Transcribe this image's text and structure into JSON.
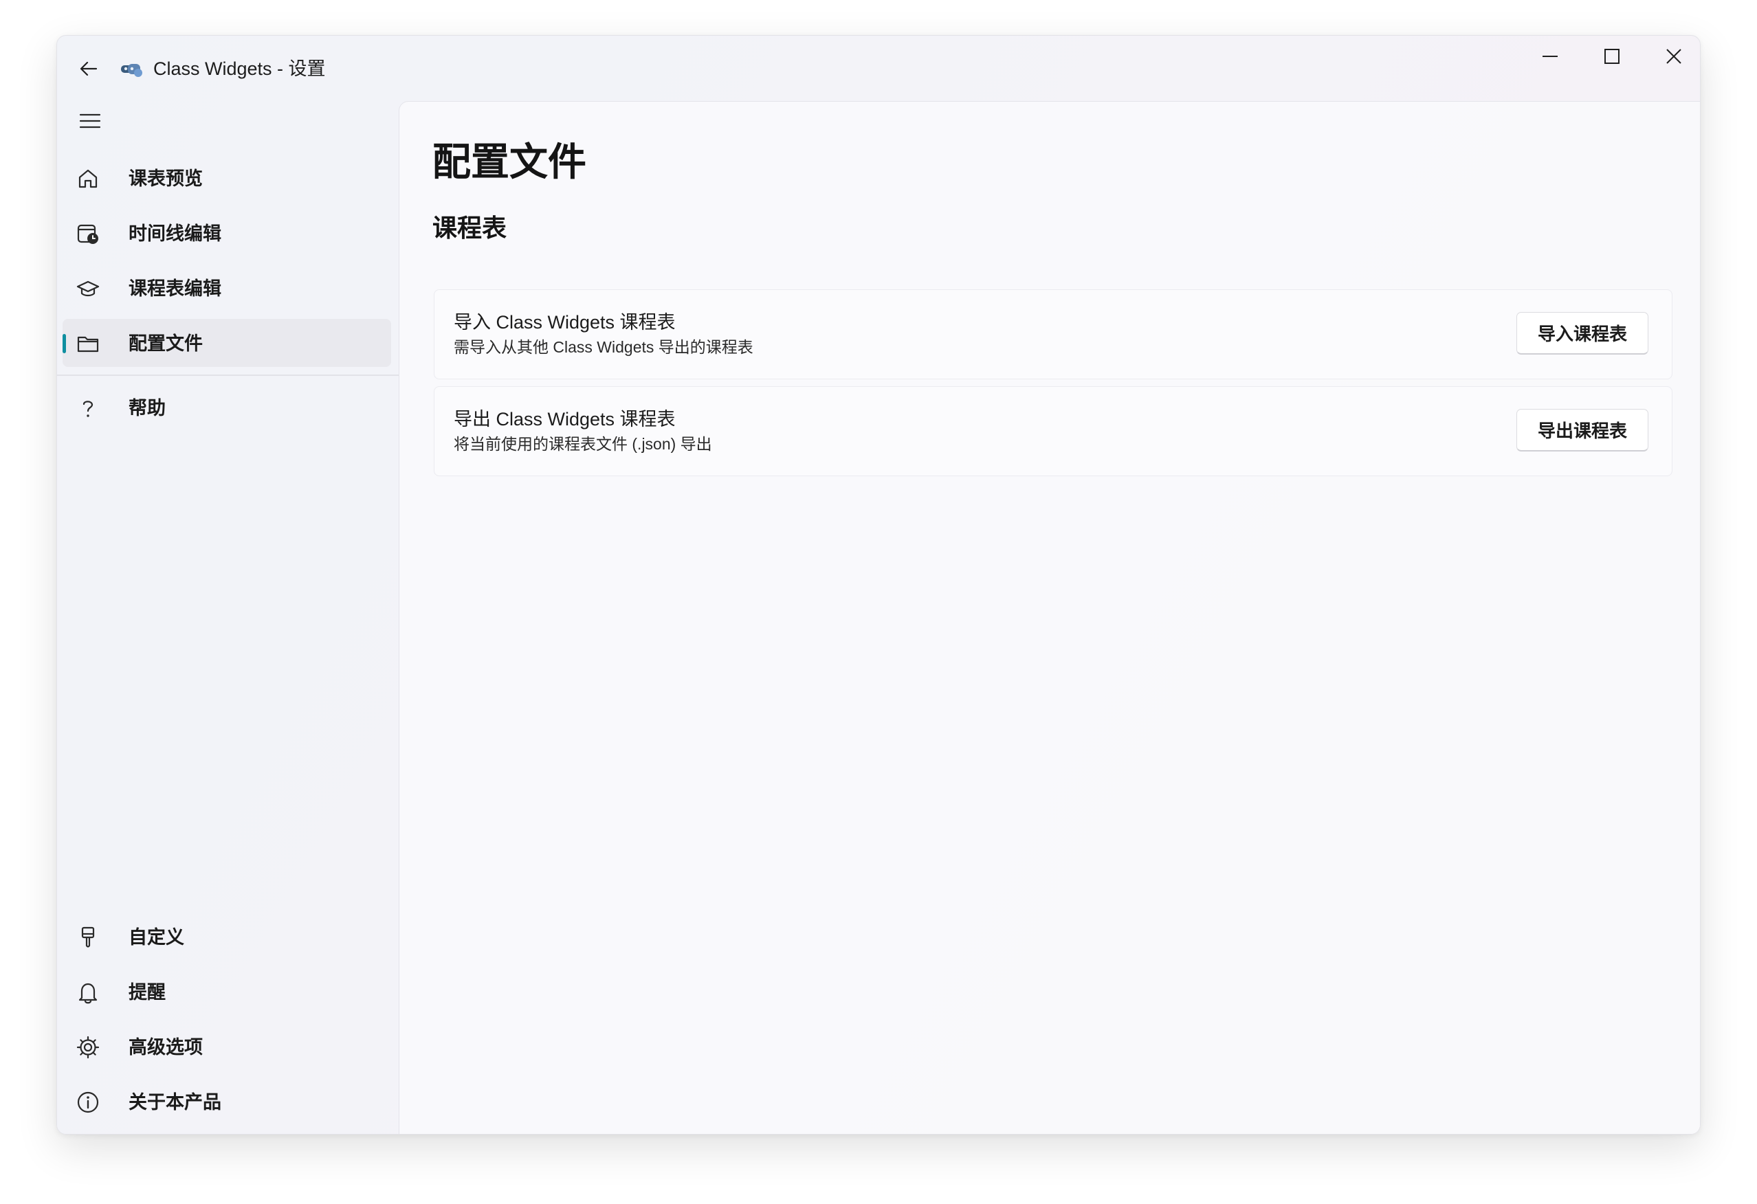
{
  "window": {
    "title": "Class Widgets - 设置"
  },
  "sidebar": {
    "top_items": [
      {
        "label": "课表预览",
        "icon": "home-icon"
      },
      {
        "label": "时间线编辑",
        "icon": "calendar-clock-icon"
      },
      {
        "label": "课程表编辑",
        "icon": "graduation-cap-icon"
      },
      {
        "label": "配置文件",
        "icon": "folder-icon",
        "selected": true
      },
      {
        "label": "帮助",
        "icon": "question-icon"
      }
    ],
    "bottom_items": [
      {
        "label": "自定义",
        "icon": "paintbrush-icon"
      },
      {
        "label": "提醒",
        "icon": "bell-icon"
      },
      {
        "label": "高级选项",
        "icon": "gear-icon"
      },
      {
        "label": "关于本产品",
        "icon": "info-icon"
      }
    ]
  },
  "main": {
    "page_title": "配置文件",
    "section_title": "课程表",
    "cards": [
      {
        "title": "导入 Class Widgets 课程表",
        "description": "需导入从其他 Class Widgets 导出的课程表",
        "button_label": "导入课程表"
      },
      {
        "title": "导出 Class Widgets 课程表",
        "description": "将当前使用的课程表文件 (.json) 导出",
        "button_label": "导出课程表"
      }
    ]
  },
  "colors": {
    "accent": "#0f8fa0",
    "selected_item_bg": "#e9e9ee"
  }
}
